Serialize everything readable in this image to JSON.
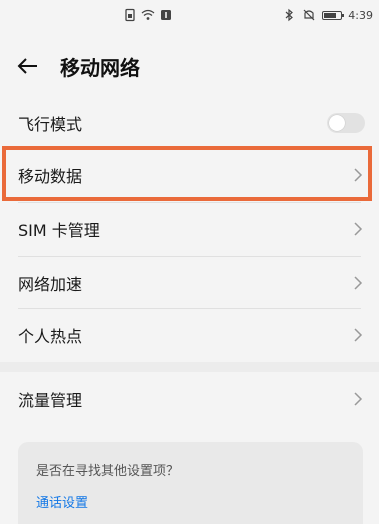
{
  "status_bar": {
    "time": "4:39",
    "icons": [
      "sim-icon",
      "wifi-icon",
      "notification-icon",
      "bluetooth-icon",
      "mute-icon",
      "battery-icon"
    ]
  },
  "header": {
    "title": "移动网络",
    "back_icon": "back-arrow-icon"
  },
  "settings": {
    "airplane_mode": {
      "label": "飞行模式",
      "enabled": false
    },
    "mobile_data": {
      "label": "移动数据"
    },
    "sim_management": {
      "label": "SIM 卡管理"
    },
    "network_acceleration": {
      "label": "网络加速"
    },
    "hotspot": {
      "label": "个人热点"
    },
    "data_usage": {
      "label": "流量管理"
    }
  },
  "highlight": {
    "color": "#ea6a3a",
    "target": "移动数据"
  },
  "suggestion": {
    "question": "是否在寻找其他设置项？",
    "link": "通话设置",
    "link_color": "#1478e6"
  }
}
